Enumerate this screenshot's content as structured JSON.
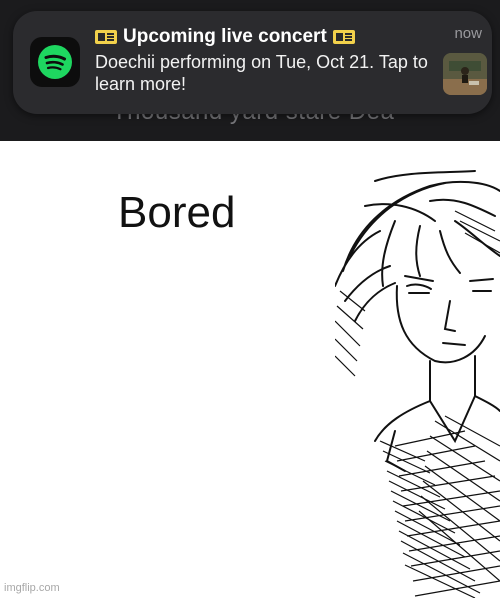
{
  "notification": {
    "app_icon": "spotify-icon",
    "title": "Upcoming live concert",
    "title_emoji": "ticket-icon",
    "body": "Doechii performing on Tue, Oct 21. Tap to learn more!",
    "time": "now"
  },
  "background_text": "Thousand yard stare Dea",
  "meme": {
    "caption": "Bored",
    "watermark": "imgflip.com"
  },
  "colors": {
    "spotify_green": "#1ed760",
    "notification_bg": "#2b2b2e",
    "strip_bg": "#1b1b1d"
  }
}
